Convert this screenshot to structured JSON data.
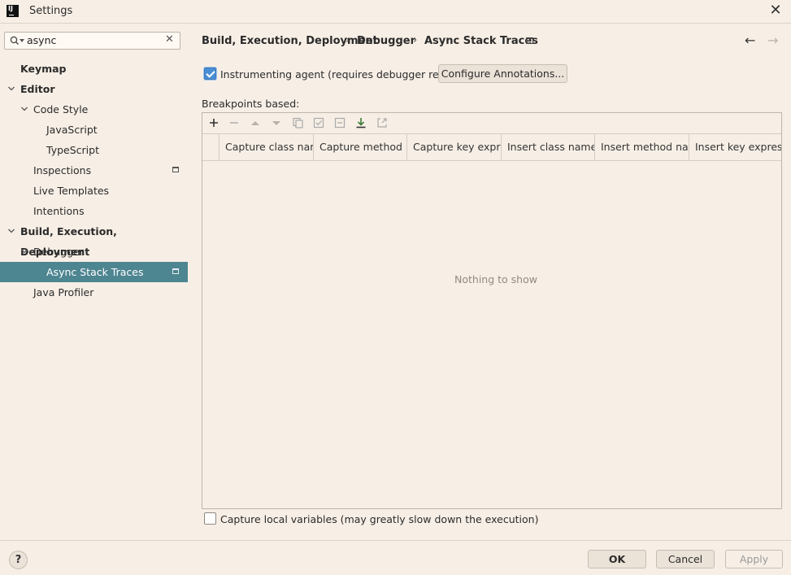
{
  "window": {
    "title": "Settings",
    "logo_text": "IJ"
  },
  "search": {
    "value": "async"
  },
  "sidebar": {
    "items": [
      {
        "label": "Keymap"
      },
      {
        "label": "Editor"
      },
      {
        "label": "Code Style"
      },
      {
        "label": "JavaScript"
      },
      {
        "label": "TypeScript"
      },
      {
        "label": "Inspections"
      },
      {
        "label": "Live Templates"
      },
      {
        "label": "Intentions"
      },
      {
        "label": "Build, Execution, Deployment"
      },
      {
        "label": "Debugger"
      },
      {
        "label": "Async Stack Traces"
      },
      {
        "label": "Java Profiler"
      }
    ]
  },
  "breadcrumb": {
    "items": [
      "Build, Execution, Deployment",
      "Debugger",
      "Async Stack Traces"
    ],
    "separator": "›"
  },
  "content": {
    "instrumenting_label": "Instrumenting agent (requires debugger restart)",
    "configure_button": "Configure Annotations...",
    "breakpoints_label": "Breakpoints based:",
    "columns": [
      "Capture class name",
      "Capture method ...",
      "Capture key expre...",
      "Insert class name",
      "Insert method na...",
      "Insert key expressi..."
    ],
    "empty_text": "Nothing to show",
    "capture_locals_label": "Capture local variables (may greatly slow down the execution)"
  },
  "footer": {
    "help": "?",
    "ok": "OK",
    "cancel": "Cancel",
    "apply": "Apply"
  },
  "colors": {
    "selection": "#4d8591",
    "background": "#f7efe6",
    "accent": "#4a8fd6"
  }
}
